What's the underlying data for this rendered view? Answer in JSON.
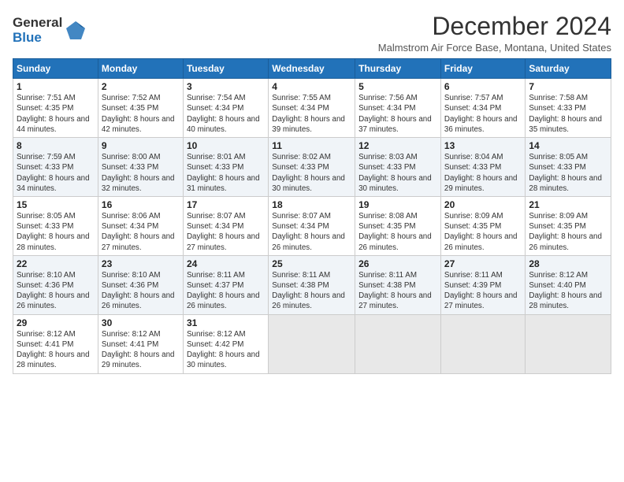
{
  "header": {
    "logo_line1": "General",
    "logo_line2": "Blue",
    "month_title": "December 2024",
    "subtitle": "Malmstrom Air Force Base, Montana, United States"
  },
  "weekdays": [
    "Sunday",
    "Monday",
    "Tuesday",
    "Wednesday",
    "Thursday",
    "Friday",
    "Saturday"
  ],
  "weeks": [
    [
      {
        "day": "1",
        "rise": "7:51 AM",
        "set": "4:35 PM",
        "hours": "8 hours and 44 minutes"
      },
      {
        "day": "2",
        "rise": "7:52 AM",
        "set": "4:35 PM",
        "hours": "8 hours and 42 minutes"
      },
      {
        "day": "3",
        "rise": "7:54 AM",
        "set": "4:34 PM",
        "hours": "8 hours and 40 minutes"
      },
      {
        "day": "4",
        "rise": "7:55 AM",
        "set": "4:34 PM",
        "hours": "8 hours and 39 minutes"
      },
      {
        "day": "5",
        "rise": "7:56 AM",
        "set": "4:34 PM",
        "hours": "8 hours and 37 minutes"
      },
      {
        "day": "6",
        "rise": "7:57 AM",
        "set": "4:34 PM",
        "hours": "8 hours and 36 minutes"
      },
      {
        "day": "7",
        "rise": "7:58 AM",
        "set": "4:33 PM",
        "hours": "8 hours and 35 minutes"
      }
    ],
    [
      {
        "day": "8",
        "rise": "7:59 AM",
        "set": "4:33 PM",
        "hours": "8 hours and 34 minutes"
      },
      {
        "day": "9",
        "rise": "8:00 AM",
        "set": "4:33 PM",
        "hours": "8 hours and 32 minutes"
      },
      {
        "day": "10",
        "rise": "8:01 AM",
        "set": "4:33 PM",
        "hours": "8 hours and 31 minutes"
      },
      {
        "day": "11",
        "rise": "8:02 AM",
        "set": "4:33 PM",
        "hours": "8 hours and 30 minutes"
      },
      {
        "day": "12",
        "rise": "8:03 AM",
        "set": "4:33 PM",
        "hours": "8 hours and 30 minutes"
      },
      {
        "day": "13",
        "rise": "8:04 AM",
        "set": "4:33 PM",
        "hours": "8 hours and 29 minutes"
      },
      {
        "day": "14",
        "rise": "8:05 AM",
        "set": "4:33 PM",
        "hours": "8 hours and 28 minutes"
      }
    ],
    [
      {
        "day": "15",
        "rise": "8:05 AM",
        "set": "4:33 PM",
        "hours": "8 hours and 28 minutes"
      },
      {
        "day": "16",
        "rise": "8:06 AM",
        "set": "4:34 PM",
        "hours": "8 hours and 27 minutes"
      },
      {
        "day": "17",
        "rise": "8:07 AM",
        "set": "4:34 PM",
        "hours": "8 hours and 27 minutes"
      },
      {
        "day": "18",
        "rise": "8:07 AM",
        "set": "4:34 PM",
        "hours": "8 hours and 26 minutes"
      },
      {
        "day": "19",
        "rise": "8:08 AM",
        "set": "4:35 PM",
        "hours": "8 hours and 26 minutes"
      },
      {
        "day": "20",
        "rise": "8:09 AM",
        "set": "4:35 PM",
        "hours": "8 hours and 26 minutes"
      },
      {
        "day": "21",
        "rise": "8:09 AM",
        "set": "4:35 PM",
        "hours": "8 hours and 26 minutes"
      }
    ],
    [
      {
        "day": "22",
        "rise": "8:10 AM",
        "set": "4:36 PM",
        "hours": "8 hours and 26 minutes"
      },
      {
        "day": "23",
        "rise": "8:10 AM",
        "set": "4:36 PM",
        "hours": "8 hours and 26 minutes"
      },
      {
        "day": "24",
        "rise": "8:11 AM",
        "set": "4:37 PM",
        "hours": "8 hours and 26 minutes"
      },
      {
        "day": "25",
        "rise": "8:11 AM",
        "set": "4:38 PM",
        "hours": "8 hours and 26 minutes"
      },
      {
        "day": "26",
        "rise": "8:11 AM",
        "set": "4:38 PM",
        "hours": "8 hours and 27 minutes"
      },
      {
        "day": "27",
        "rise": "8:11 AM",
        "set": "4:39 PM",
        "hours": "8 hours and 27 minutes"
      },
      {
        "day": "28",
        "rise": "8:12 AM",
        "set": "4:40 PM",
        "hours": "8 hours and 28 minutes"
      }
    ],
    [
      {
        "day": "29",
        "rise": "8:12 AM",
        "set": "4:41 PM",
        "hours": "8 hours and 28 minutes"
      },
      {
        "day": "30",
        "rise": "8:12 AM",
        "set": "4:41 PM",
        "hours": "8 hours and 29 minutes"
      },
      {
        "day": "31",
        "rise": "8:12 AM",
        "set": "4:42 PM",
        "hours": "8 hours and 30 minutes"
      },
      null,
      null,
      null,
      null
    ]
  ]
}
